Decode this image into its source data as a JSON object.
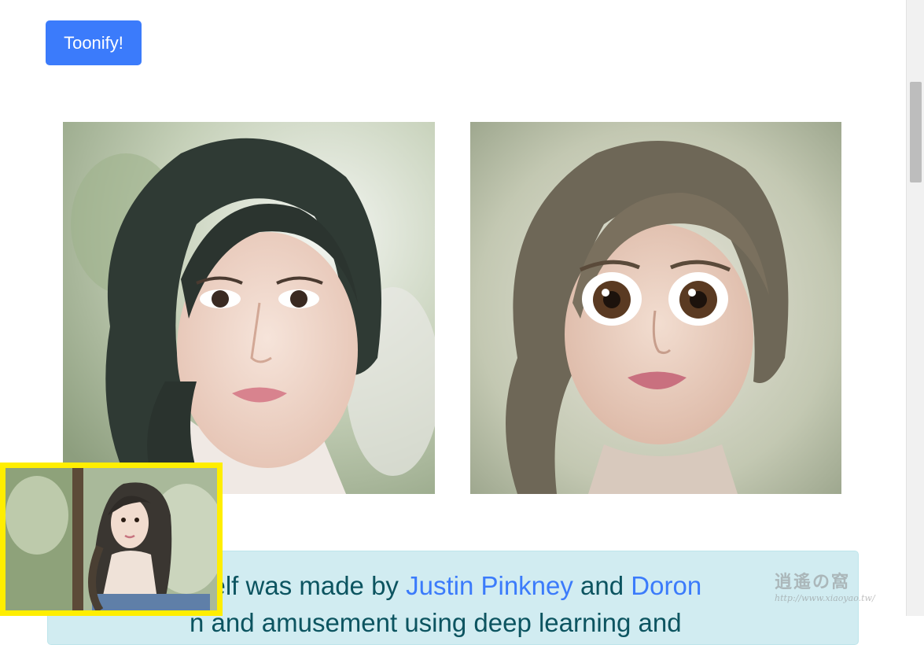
{
  "toolbar": {
    "toonify_label": "Toonify!"
  },
  "images": {
    "input_alt": "input face photo",
    "output_alt": "toonified face result"
  },
  "alert": {
    "text_a": "rself was made by ",
    "link_1": "Justin Pinkney",
    "text_b": " and ",
    "link_2": "Doron",
    "line2": "n and amusement using deep learning and"
  },
  "watermark": {
    "mark": "逍遙の窩",
    "url": "http://www.xiaoyao.tw/"
  }
}
